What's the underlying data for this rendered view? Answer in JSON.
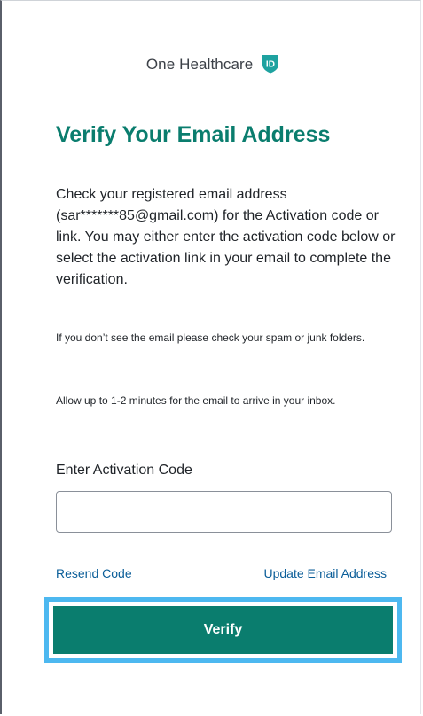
{
  "brand": {
    "name": "One Healthcare",
    "badge_text": "ID",
    "accent_color": "#0a7d6e",
    "badge_color": "#1ea2a0"
  },
  "page": {
    "title": "Verify Your Email Address",
    "instructions": "Check your registered email address (sar*******85@gmail.com) for the Activation code or link. You may either enter the activation code below or select the activation link in your email to complete the verification.",
    "note_spam": "If you don’t see the email please check your spam or junk folders.",
    "note_timing": "Allow up to 1-2 minutes for the email to arrive in your inbox."
  },
  "form": {
    "code_label": "Enter Activation Code",
    "code_value": "",
    "code_placeholder": ""
  },
  "links": {
    "resend": "Resend Code",
    "update_email": "Update Email Address"
  },
  "actions": {
    "verify_label": "Verify",
    "focus_ring_color": "#4db8f0"
  }
}
